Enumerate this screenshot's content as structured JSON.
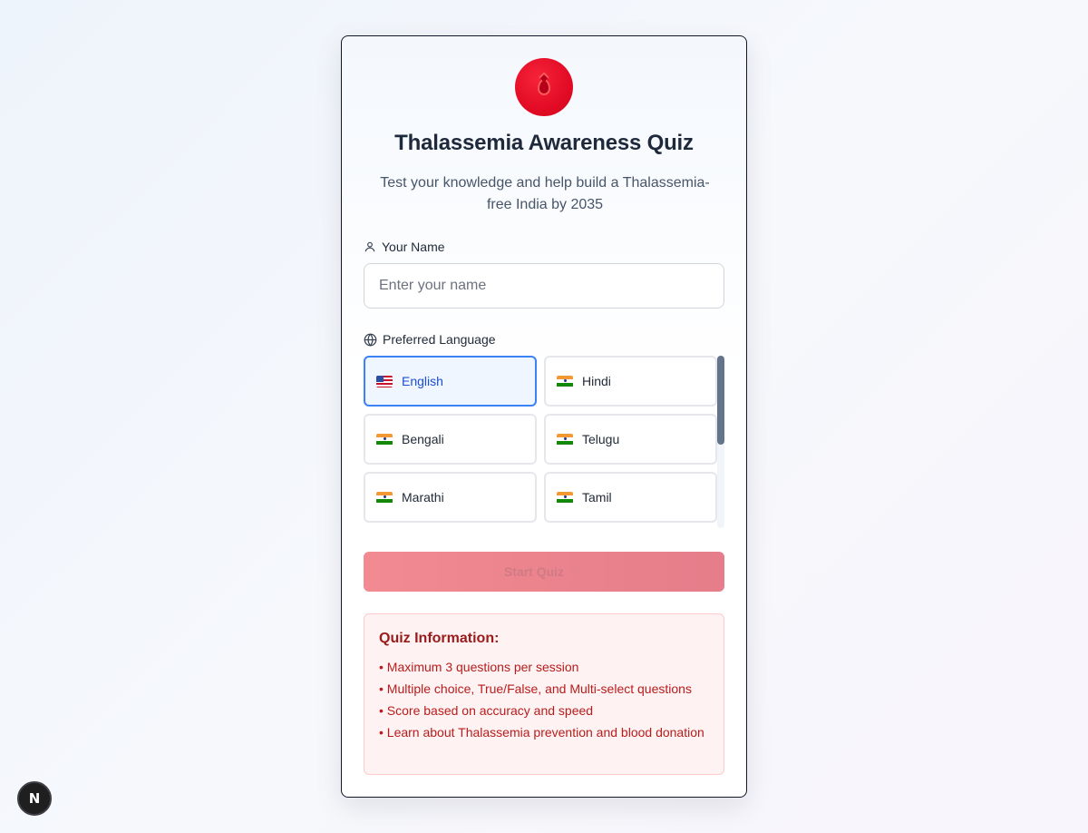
{
  "quiz": {
    "title": "Thalassemia Awareness Quiz",
    "subtitle": "Test your knowledge and help build a Thalassemia-free India by 2035",
    "logo_icon": "blood-drop-icon",
    "brand_color": "#e30b25"
  },
  "form": {
    "name_label": "Your Name",
    "name_placeholder": "Enter your name",
    "name_value": "",
    "language_label": "Preferred Language",
    "languages": [
      {
        "label": "English",
        "flag": "us-flag-icon",
        "selected": true
      },
      {
        "label": "Hindi",
        "flag": "india-flag-icon",
        "selected": false
      },
      {
        "label": "Bengali",
        "flag": "india-flag-icon",
        "selected": false
      },
      {
        "label": "Telugu",
        "flag": "india-flag-icon",
        "selected": false
      },
      {
        "label": "Marathi",
        "flag": "india-flag-icon",
        "selected": false
      },
      {
        "label": "Tamil",
        "flag": "india-flag-icon",
        "selected": false
      }
    ],
    "start_label": "Start Quiz",
    "start_disabled": true
  },
  "info": {
    "title": "Quiz Information:",
    "items": [
      "• Maximum 3 questions per session",
      "• Multiple choice, True/False, and Multi-select questions",
      "• Score based on accuracy and speed",
      "• Learn about Thalassemia prevention and blood donation"
    ]
  },
  "dev_badge": {
    "label": "N"
  }
}
